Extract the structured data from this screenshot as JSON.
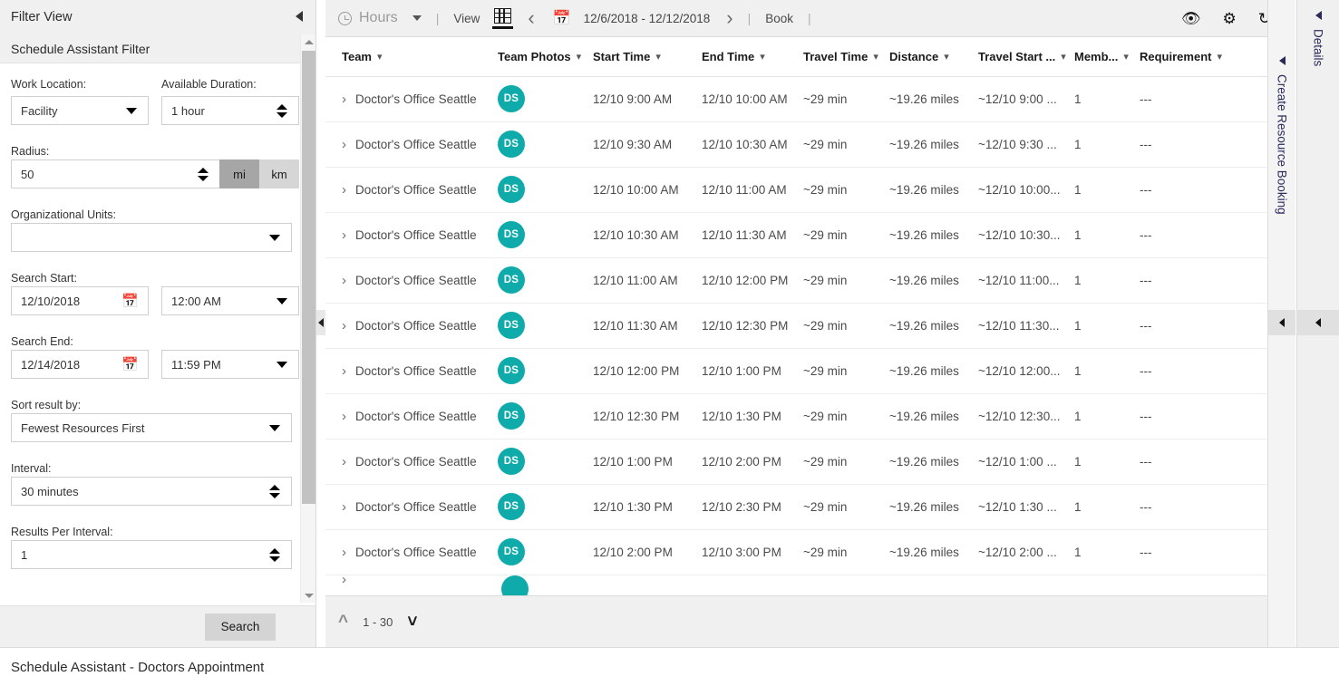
{
  "filter_panel": {
    "header_title": "Filter View",
    "subheader_title": "Schedule Assistant Filter",
    "collapse_icon": "left-caret-icon",
    "fields": {
      "work_location": {
        "label": "Work Location:",
        "value": "Facility"
      },
      "available_duration": {
        "label": "Available Duration:",
        "value": "1 hour"
      },
      "radius": {
        "label": "Radius:",
        "value": "50",
        "unit_mi": "mi",
        "unit_km": "km",
        "active_unit": "mi"
      },
      "organizational_units": {
        "label": "Organizational Units:",
        "value": ""
      },
      "search_start": {
        "label": "Search Start:",
        "date": "12/10/2018",
        "time": "12:00 AM"
      },
      "search_end": {
        "label": "Search End:",
        "date": "12/14/2018",
        "time": "11:59 PM"
      },
      "sort_result_by": {
        "label": "Sort result by:",
        "value": "Fewest Resources First"
      },
      "interval": {
        "label": "Interval:",
        "value": "30 minutes"
      },
      "results_per_interval": {
        "label": "Results Per Interval:",
        "value": "1"
      }
    },
    "search_button": "Search"
  },
  "toolbar": {
    "hours_label": "Hours",
    "separator": "|",
    "view_label": "View",
    "date_range": "12/6/2018 - 12/12/2018",
    "book_label": "Book",
    "icons": {
      "clock": "clock-icon",
      "dropdown": "chevron-down-icon",
      "grid_view": "grid-view-icon",
      "prev": "‹",
      "next": "›",
      "calendar": "📅",
      "eye": "👁",
      "gear": "⚙",
      "refresh": "↻"
    }
  },
  "grid": {
    "columns": [
      "Team",
      "Team Photos",
      "Start Time",
      "End Time",
      "Travel Time",
      "Distance",
      "Travel Start ...",
      "Memb...",
      "Requirement"
    ],
    "avatar_color": "#0fabab",
    "rows": [
      {
        "team": "Doctor's Office Seattle",
        "initials": "DS",
        "start": "12/10 9:00 AM",
        "end": "12/10 10:00 AM",
        "travel_time": "~29 min",
        "distance": "~19.26 miles",
        "travel_start": "~12/10 9:00 ...",
        "members": "1",
        "requirement": "---"
      },
      {
        "team": "Doctor's Office Seattle",
        "initials": "DS",
        "start": "12/10 9:30 AM",
        "end": "12/10 10:30 AM",
        "travel_time": "~29 min",
        "distance": "~19.26 miles",
        "travel_start": "~12/10 9:30 ...",
        "members": "1",
        "requirement": "---"
      },
      {
        "team": "Doctor's Office Seattle",
        "initials": "DS",
        "start": "12/10 10:00 AM",
        "end": "12/10 11:00 AM",
        "travel_time": "~29 min",
        "distance": "~19.26 miles",
        "travel_start": "~12/10 10:00...",
        "members": "1",
        "requirement": "---"
      },
      {
        "team": "Doctor's Office Seattle",
        "initials": "DS",
        "start": "12/10 10:30 AM",
        "end": "12/10 11:30 AM",
        "travel_time": "~29 min",
        "distance": "~19.26 miles",
        "travel_start": "~12/10 10:30...",
        "members": "1",
        "requirement": "---"
      },
      {
        "team": "Doctor's Office Seattle",
        "initials": "DS",
        "start": "12/10 11:00 AM",
        "end": "12/10 12:00 PM",
        "travel_time": "~29 min",
        "distance": "~19.26 miles",
        "travel_start": "~12/10 11:00...",
        "members": "1",
        "requirement": "---"
      },
      {
        "team": "Doctor's Office Seattle",
        "initials": "DS",
        "start": "12/10 11:30 AM",
        "end": "12/10 12:30 PM",
        "travel_time": "~29 min",
        "distance": "~19.26 miles",
        "travel_start": "~12/10 11:30...",
        "members": "1",
        "requirement": "---"
      },
      {
        "team": "Doctor's Office Seattle",
        "initials": "DS",
        "start": "12/10 12:00 PM",
        "end": "12/10 1:00 PM",
        "travel_time": "~29 min",
        "distance": "~19.26 miles",
        "travel_start": "~12/10 12:00...",
        "members": "1",
        "requirement": "---"
      },
      {
        "team": "Doctor's Office Seattle",
        "initials": "DS",
        "start": "12/10 12:30 PM",
        "end": "12/10 1:30 PM",
        "travel_time": "~29 min",
        "distance": "~19.26 miles",
        "travel_start": "~12/10 12:30...",
        "members": "1",
        "requirement": "---"
      },
      {
        "team": "Doctor's Office Seattle",
        "initials": "DS",
        "start": "12/10 1:00 PM",
        "end": "12/10 2:00 PM",
        "travel_time": "~29 min",
        "distance": "~19.26 miles",
        "travel_start": "~12/10 1:00 ...",
        "members": "1",
        "requirement": "---"
      },
      {
        "team": "Doctor's Office Seattle",
        "initials": "DS",
        "start": "12/10 1:30 PM",
        "end": "12/10 2:30 PM",
        "travel_time": "~29 min",
        "distance": "~19.26 miles",
        "travel_start": "~12/10 1:30 ...",
        "members": "1",
        "requirement": "---"
      },
      {
        "team": "Doctor's Office Seattle",
        "initials": "DS",
        "start": "12/10 2:00 PM",
        "end": "12/10 3:00 PM",
        "travel_time": "~29 min",
        "distance": "~19.26 miles",
        "travel_start": "~12/10 2:00 ...",
        "members": "1",
        "requirement": "---"
      }
    ]
  },
  "pager": {
    "up_icon": "chevron-up-icon",
    "range_label": "1 - 30",
    "down_icon": "chevron-down-icon"
  },
  "rails": {
    "create_booking_label": "Create Resource Booking",
    "details_label": "Details"
  },
  "statusbar": {
    "text": "Schedule Assistant - Doctors Appointment"
  }
}
